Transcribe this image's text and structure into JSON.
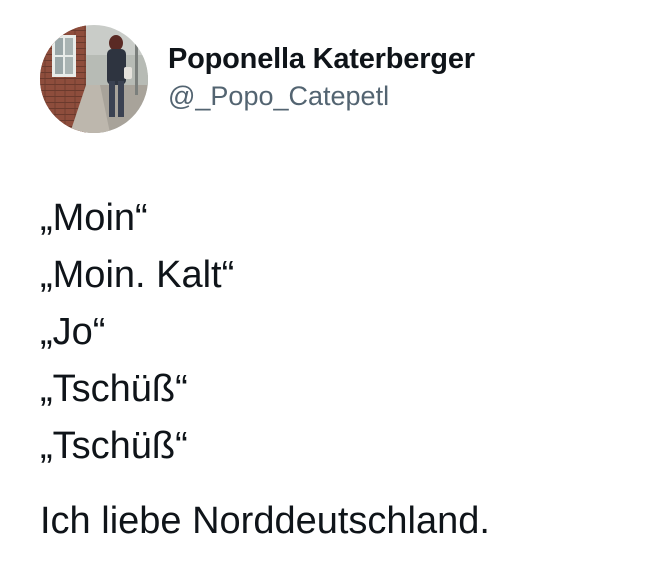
{
  "author": {
    "display_name": "Poponella Katerberger",
    "handle": "@_Popo_Catepetl",
    "avatar": "profile-photo-person-walking-on-street"
  },
  "tweet": {
    "lines": [
      "„Moin“",
      "„Moin. Kalt“",
      "„Jo“",
      "„Tschüß“",
      "„Tschüß“"
    ],
    "closing": "Ich liebe Norddeutschland."
  },
  "colors": {
    "text": "#0f1419",
    "secondary_text": "#536471",
    "background": "#ffffff"
  }
}
